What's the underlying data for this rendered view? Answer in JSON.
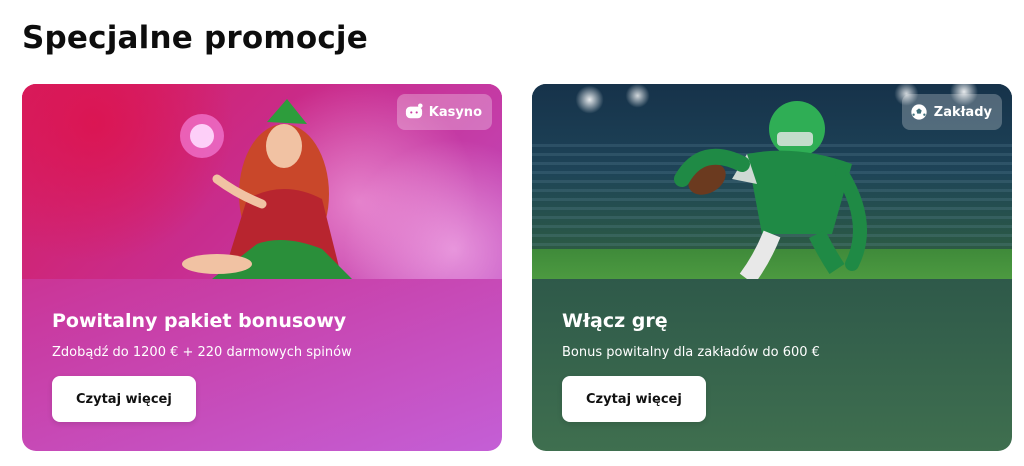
{
  "section": {
    "title": "Specjalne promocje"
  },
  "promotions": [
    {
      "badge": "Kasyno",
      "badge_icon": "gamepad-icon",
      "title": "Powitalny pakiet bonusowy",
      "description": "Zdobądź do 1200 € + 220 darmowych spinów",
      "button": "Czytaj więcej",
      "accent": "#d41f6a"
    },
    {
      "badge": "Zakłady",
      "badge_icon": "soccer-ball-icon",
      "title": "Włącz grę",
      "description": "Bonus powitalny dla zakładów do 600 €",
      "button": "Czytaj więcej",
      "accent": "#2f5a4a"
    }
  ]
}
